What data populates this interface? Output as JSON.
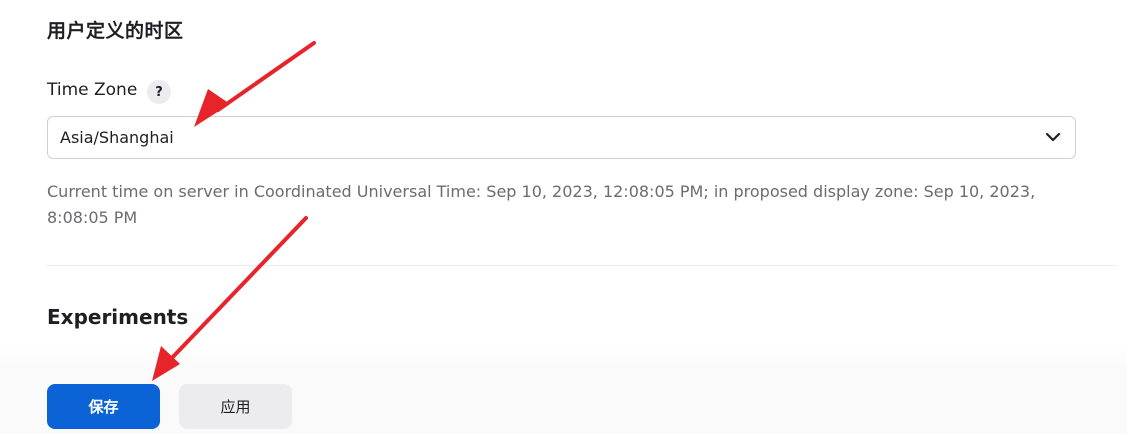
{
  "timezone_section": {
    "title": "用户定义的时区",
    "label": "Time Zone",
    "help_symbol": "?",
    "selected_value": "Asia/Shanghai",
    "description": "Current time on server in Coordinated Universal Time: Sep 10, 2023, 12:08:05 PM; in proposed display zone: Sep 10, 2023, 8:08:05 PM"
  },
  "experiments_section": {
    "title": "Experiments"
  },
  "actions": {
    "save_label": "保存",
    "apply_label": "应用"
  },
  "colors": {
    "primary": "#0b63d6",
    "annotation_arrow": "#e8242b",
    "help_text": "#6b6b74"
  },
  "icons": {
    "select_chevron": "chevron-down-icon",
    "help": "help-icon"
  }
}
